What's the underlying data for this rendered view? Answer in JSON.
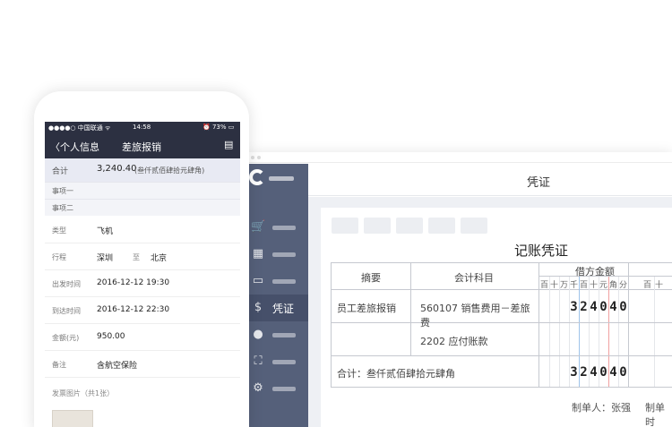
{
  "desktop": {
    "header_title": "凭证",
    "sidebar": {
      "active_label": "凭证"
    },
    "voucher": {
      "title": "记账凭证",
      "col_summary": "摘要",
      "col_account": "会计科目",
      "col_debit": "借方金额",
      "digit_units": [
        "百",
        "十",
        "万",
        "千",
        "百",
        "十",
        "元",
        "角",
        "分",
        "百",
        "十"
      ],
      "rows": [
        {
          "summary": "员工差旅报销",
          "account": "560107 销售费用－差旅费",
          "amount_digits": [
            "3",
            "2",
            "4",
            "0",
            "4",
            "0"
          ]
        },
        {
          "summary": "",
          "account": "2202 应付账款",
          "amount_digits": []
        }
      ],
      "total_label": "合计：叁仟贰佰肆拾元肆角",
      "total_digits": [
        "3",
        "2",
        "4",
        "0",
        "4",
        "0"
      ],
      "maker": "制单人：张强",
      "reviewer": "制单时"
    }
  },
  "phone": {
    "status": {
      "carrier": "●●●●○ 中国联通 ᯤ",
      "time": "14:58",
      "battery": "⏰ 73% ▭"
    },
    "nav": {
      "back": "〈个人信息",
      "title": "差旅报销",
      "menu": "▤"
    },
    "summary": {
      "label": "合计",
      "amount": "3,240.40",
      "caps": "(叁仟贰佰肆拾元肆角)"
    },
    "items": [
      "事项一",
      "事项二"
    ],
    "fields": [
      {
        "key": "类型",
        "value": "飞机"
      },
      {
        "key": "行程",
        "from": "深圳",
        "sep": "至",
        "to": "北京"
      },
      {
        "key": "出发时间",
        "value": "2016-12-12 19:30"
      },
      {
        "key": "到达时间",
        "value": "2016-12-12 22:30"
      },
      {
        "key": "金额(元)",
        "value": "950.00"
      },
      {
        "key": "备注",
        "value": "含航空保险"
      }
    ],
    "invoice_label": "发票图片（共1张）"
  },
  "icons": [
    "logo-icon",
    "cart-icon",
    "calendar-icon",
    "monitor-icon",
    "voucher-icon",
    "bulb-icon",
    "scan-icon",
    "gear-icon"
  ]
}
